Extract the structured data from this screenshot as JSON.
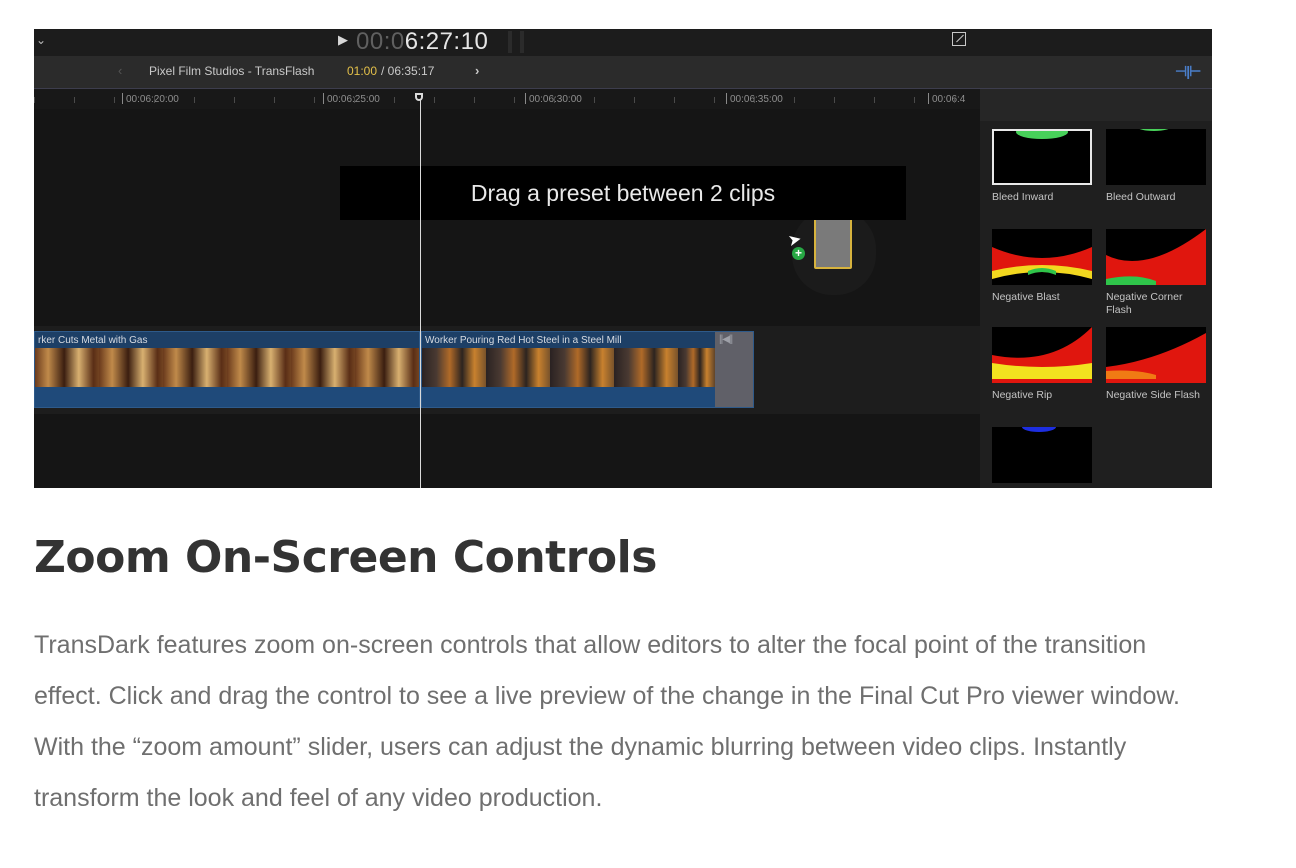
{
  "fcp": {
    "timecode_dim": "00:0",
    "timecode_bright": "6:27:10",
    "project_name": "Pixel Film Studios - TransFlash",
    "time_current": "01:00",
    "time_total": "/ 06:35:17",
    "ruler_labels": [
      "00:06:20:00",
      "00:06:25:00",
      "00:06:30:00",
      "00:06:35:00",
      "00:06:4"
    ],
    "tip": "Drag a preset between 2 clips",
    "clips": [
      {
        "title": "rker Cuts Metal with Gas"
      },
      {
        "title": "Worker Pouring Red Hot Steel in a Steel Mill"
      }
    ],
    "presets": [
      {
        "label": "Bleed Inward",
        "selected": true
      },
      {
        "label": "Bleed Outward"
      },
      {
        "label": "Negative Blast"
      },
      {
        "label": "Negative Corner Flash"
      },
      {
        "label": "Negative Rip"
      },
      {
        "label": "Negative Side Flash"
      },
      {
        "label": ""
      }
    ]
  },
  "article": {
    "heading": "Zoom On-Screen Controls",
    "body": "TransDark features zoom on-screen controls that allow editors to alter the focal point of the transition effect.  Click and drag the control to see a live preview of the change in the Final Cut Pro viewer window.  With the “zoom amount” slider, users can adjust the dynamic blurring between video clips.  Instantly transform the look and feel of any video production."
  },
  "icons": {
    "play": "play-icon",
    "fullscreen": "fullscreen-icon",
    "cursor": "cursor-icon",
    "add_badge": "add-badge-icon"
  },
  "colors": {
    "timecode_highlight": "#e3c04a",
    "clip_blue": "#1d3f66",
    "selection_gold": "#d7b33e",
    "heading": "#333333",
    "body_text": "#6f6f6f"
  }
}
